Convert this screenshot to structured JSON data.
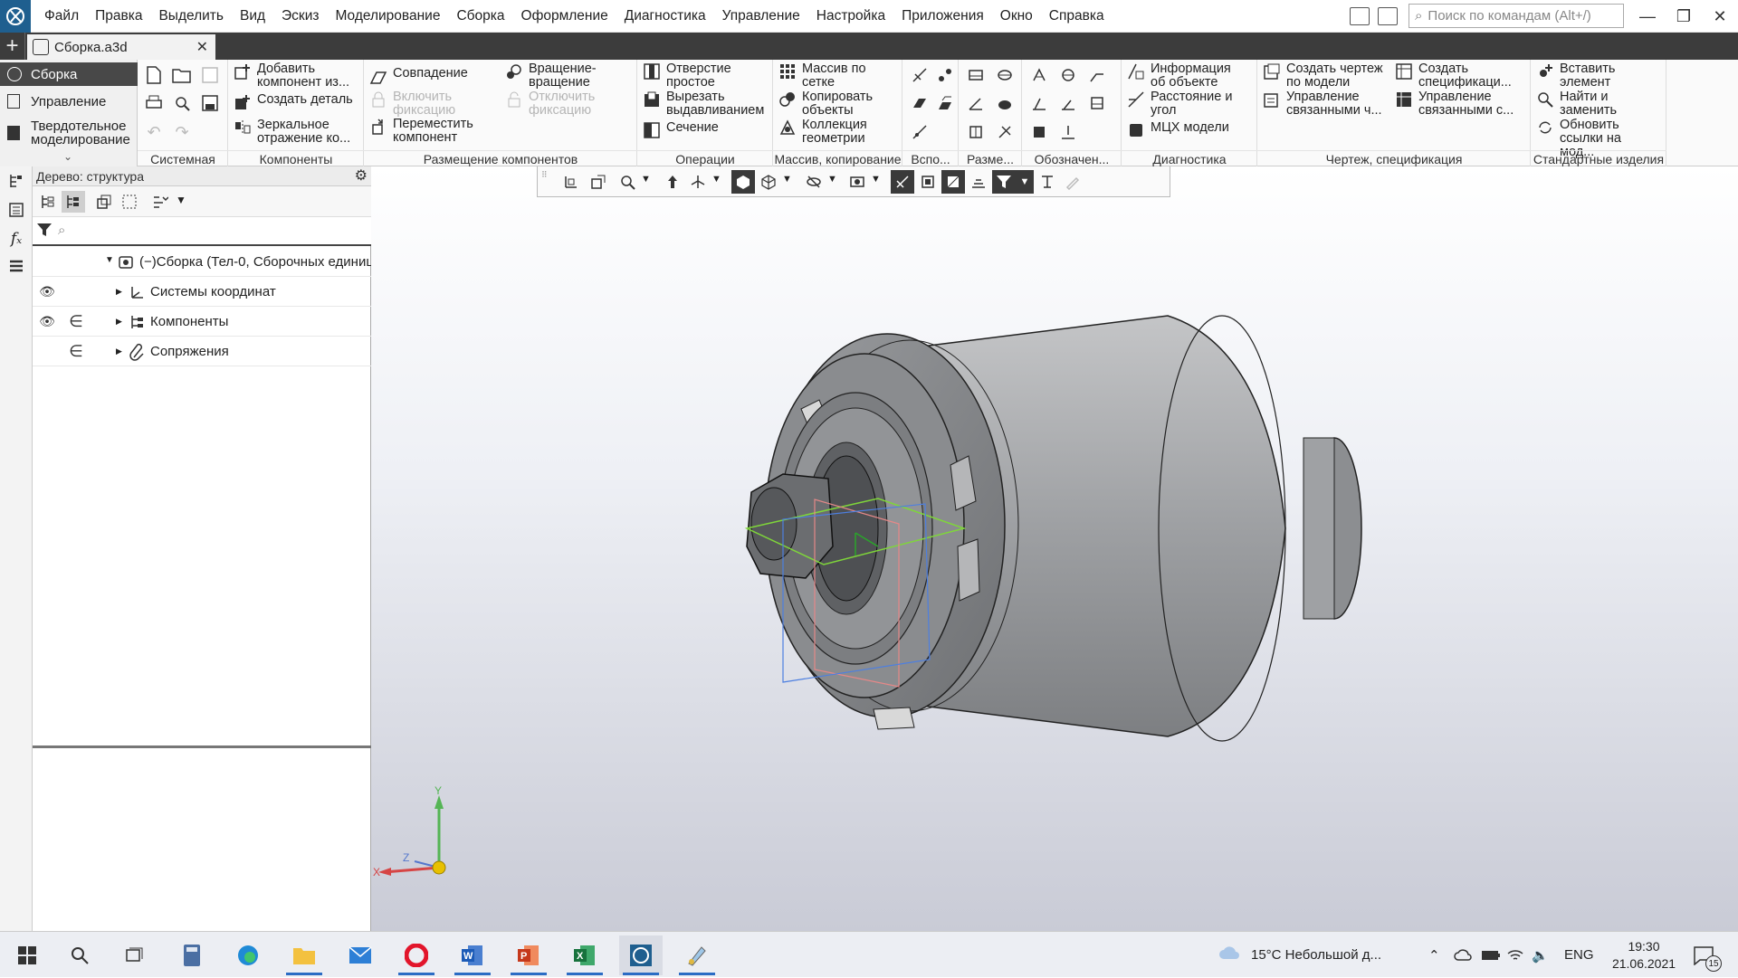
{
  "menu": [
    "Файл",
    "Правка",
    "Выделить",
    "Вид",
    "Эскиз",
    "Моделирование",
    "Сборка",
    "Оформление",
    "Диагностика",
    "Управление",
    "Настройка",
    "Приложения",
    "Окно",
    "Справка"
  ],
  "search": {
    "placeholder": "Поиск по командам (Alt+/)"
  },
  "tab": {
    "title": "Сборка.a3d"
  },
  "modes": {
    "assembly": "Сборка",
    "control": "Управление",
    "solid": "Твердотельное моделирование"
  },
  "ribbon": {
    "add_component": "Добавить компонент из...",
    "create_part": "Создать деталь",
    "mirror": "Зеркальное отражение ко...",
    "coincidence": "Совпадение",
    "rotation": "Вращение-вращение",
    "enable_fix": "Включить фиксацию",
    "disable_fix": "Отключить фиксацию",
    "move_component": "Переместить компонент",
    "hole": "Отверстие простое",
    "cut_extrude": "Вырезать выдавливанием",
    "section": "Сечение",
    "grid_array": "Массив по сетке",
    "copy_objects": "Копировать объекты",
    "geometry_collection": "Коллекция геометрии",
    "object_info": "Информация об объекте",
    "distance_angle": "Расстояние и угол",
    "mass_props": "МЦХ модели",
    "create_drawing": "Создать чертеж по модели",
    "manage_linked_drawings": "Управление связанными ч...",
    "create_spec": "Создать спецификаци...",
    "manage_linked_specs": "Управление связанными с...",
    "insert_element": "Вставить элемент",
    "find_replace": "Найти и заменить",
    "update_links": "Обновить ссылки на мод..."
  },
  "groups": {
    "system": "Системная",
    "components": "Компоненты",
    "placement": "Размещение компонентов",
    "operations": "Операции",
    "array_copy": "Массив, копирование",
    "aux": "Вспо...",
    "dims": "Разме...",
    "designations": "Обозначен...",
    "diagnostics": "Диагностика",
    "drawing_spec": "Чертеж, спецификация",
    "std_parts": "Стандартные изделия"
  },
  "tree": {
    "header": "Дерево: структура",
    "root": "Сборка (Тел-0, Сборочных единиц",
    "items": [
      "Системы координат",
      "Компоненты",
      "Сопряжения"
    ]
  },
  "axes": {
    "x": "X",
    "y": "Y",
    "z": "Z"
  },
  "taskbar": {
    "weather": "15°C  Небольшой д...",
    "lang": "ENG",
    "time": "19:30",
    "date": "21.06.2021",
    "notifications": "15"
  }
}
